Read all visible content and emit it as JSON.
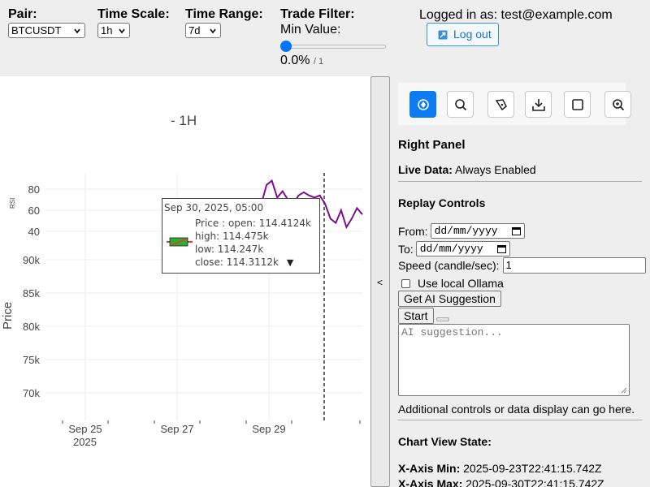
{
  "controls": {
    "pair": {
      "label": "Pair:",
      "value": "BTCUSDT"
    },
    "time_scale": {
      "label": "Time Scale:",
      "value": "1h"
    },
    "time_range": {
      "label": "Time Range:",
      "value": "7d"
    },
    "trade_filter": {
      "label": "Trade Filter:",
      "min_label": "Min Value:",
      "percent": "0.0%",
      "max": "/ 1",
      "slider_fraction": 0.0
    }
  },
  "user": {
    "logged_in_text": "Logged in as: test@example.com",
    "logout_label": "Log out"
  },
  "chart": {
    "title": "- 1H",
    "rsi_label": "RSI",
    "price_label": "Price",
    "rsi_ticks": [
      "80",
      "60",
      "40"
    ],
    "price_ticks": [
      "90k",
      "85k",
      "80k",
      "75k",
      "70k"
    ],
    "x_ticks": [
      "Sep 25",
      "Sep 27",
      "Sep 29"
    ],
    "x_year": "2025",
    "tooltip": {
      "date": "Sep 30, 2025, 05:00",
      "line1": "Price : open: 114.4124k",
      "line2": "high: 114.475k",
      "line3": "low: 114.247k",
      "line4": "close: 114.3112k",
      "arrow": "▼"
    },
    "colors": {
      "rsi_line": "#7b0f8f",
      "candle_up": "#2eae2e",
      "candle_down": "#e23b3b",
      "grid": "#eeeeee"
    }
  },
  "chart_data": {
    "type": "line",
    "title": "- 1H",
    "xlabel": "",
    "ylabel": "Price",
    "series": [
      {
        "name": "RSI",
        "values": [
          60,
          66,
          84,
          88,
          72,
          78,
          70,
          66,
          74,
          77,
          74,
          72,
          74,
          66,
          52,
          48,
          60,
          44,
          52,
          62,
          56
        ]
      }
    ],
    "rsi_range": [
      30,
      90
    ],
    "price_range": [
      67000,
      93000
    ],
    "grid": true
  },
  "collapse": {
    "label": "<"
  },
  "right_panel": {
    "toolbar": [
      "pan-icon",
      "zoom-area-icon",
      "draw-icon",
      "download-icon",
      "box-select-icon",
      "zoom-in-icon"
    ],
    "title": "Right Panel",
    "live_label": "Live Data:",
    "live_value": "Always Enabled",
    "replay_title": "Replay Controls",
    "from_label": "From:",
    "to_label": "To:",
    "date_placeholder": "dd/mm/yyyy",
    "speed_label": "Speed (candle/sec):",
    "speed_value": "1",
    "ollama_label": "Use local Ollama",
    "ai_button": "Get AI Suggestion",
    "start_button": "Start",
    "ai_placeholder": "AI suggestion...",
    "additional_text": "Additional controls or data display can go here.",
    "view_state_title": "Chart View State:",
    "x_min_label": "X-Axis Min:",
    "x_min_value": "2025-09-23T22:41:15.742Z",
    "x_max_label": "X-Axis Max:",
    "x_max_value": "2025-09-30T22:41:15.742Z"
  }
}
